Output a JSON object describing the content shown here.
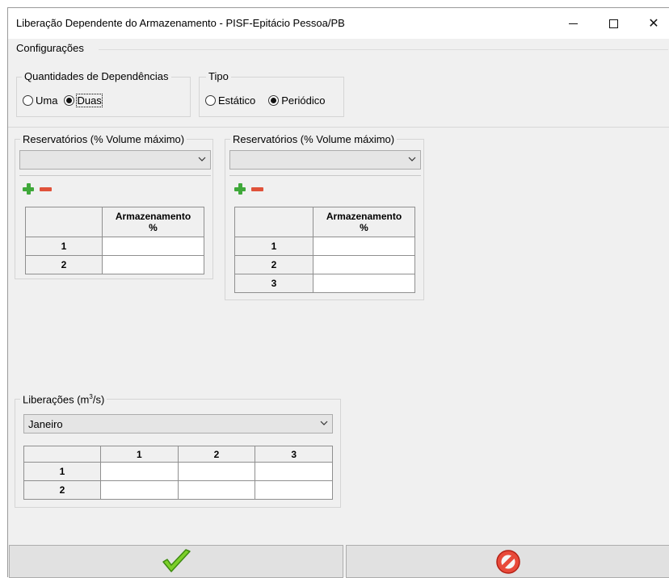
{
  "window": {
    "title": "Liberação Dependente do Armazenamento - PISF-Epitácio Pessoa/PB"
  },
  "config": {
    "label": "Configurações",
    "quantidades": {
      "label": "Quantidades de Dependências",
      "options": [
        "Uma",
        "Duas"
      ],
      "selected": "Duas"
    },
    "tipo": {
      "label": "Tipo",
      "options": [
        "Estático",
        "Periódico"
      ],
      "selected": "Periódico"
    }
  },
  "reservoir1": {
    "label": "Reservatórios (% Volume máximo)",
    "combo_value": "",
    "column_header": [
      "Armazenamento",
      "%"
    ],
    "rows": [
      "1",
      "2"
    ]
  },
  "reservoir2": {
    "label": "Reservatórios (% Volume máximo)",
    "combo_value": "",
    "column_header": [
      "Armazenamento",
      "%"
    ],
    "rows": [
      "1",
      "2",
      "3"
    ]
  },
  "liberacoes": {
    "label_main": "Liberações (m",
    "label_sup": "3",
    "label_tail": "/s)",
    "month": "Janeiro",
    "columns": [
      "1",
      "2",
      "3"
    ],
    "rows": [
      "1",
      "2"
    ]
  },
  "footer": {
    "confirm_icon": "green-checkmark-icon",
    "cancel_icon": "red-prohibited-icon"
  }
}
